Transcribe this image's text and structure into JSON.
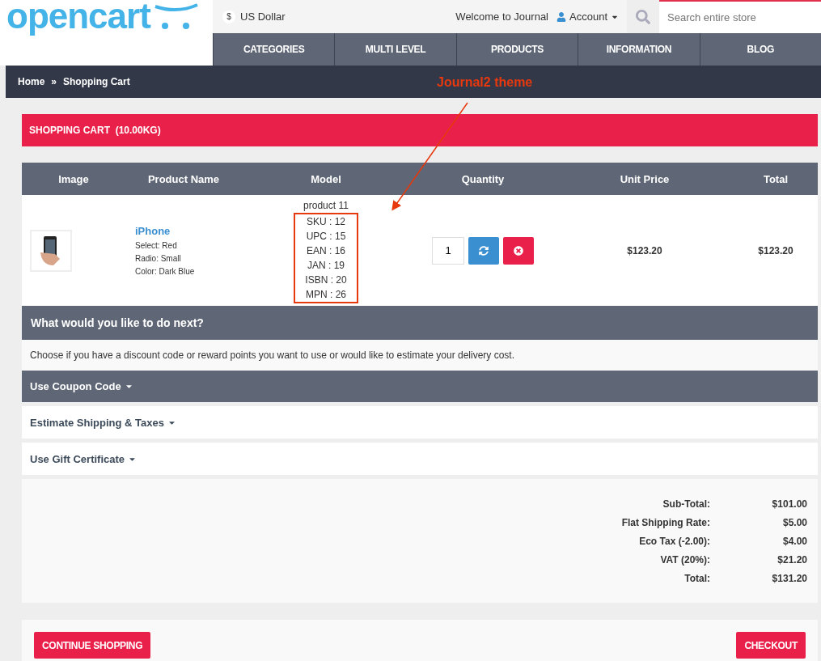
{
  "header": {
    "logo": "opencart",
    "currency_symbol": "$",
    "currency": "US Dollar",
    "welcome": "Welcome to Journal",
    "account": "Account",
    "search": {
      "placeholder": "Search entire store"
    }
  },
  "nav": [
    "CATEGORIES",
    "MULTI LEVEL",
    "PRODUCTS",
    "INFORMATION",
    "BLOG"
  ],
  "breadcrumb": [
    "Home",
    "»",
    "Shopping Cart"
  ],
  "annotation": "Journal2 theme",
  "cart": {
    "title": "SHOPPING CART  (10.00KG)",
    "columns": [
      "Image",
      "Product Name",
      "Model",
      "Quantity",
      "Unit Price",
      "Total"
    ],
    "rows": [
      {
        "name": "iPhone",
        "options": [
          "Select: Red",
          "Radio: Small",
          "Color: Dark Blue"
        ],
        "model": "product 11",
        "codes": [
          "SKU : 12",
          "UPC : 15",
          "EAN : 16",
          "JAN : 19",
          "ISBN : 20",
          "MPN : 26"
        ],
        "quantity": "1",
        "unit_price": "$123.20",
        "total": "$123.20"
      }
    ]
  },
  "next": {
    "title": "What would you like to do next?",
    "description": "Choose if you have a discount code or reward points you want to use or would like to estimate your delivery cost.",
    "sections": [
      {
        "label": "Use Coupon Code",
        "selected": true
      },
      {
        "label": "Estimate Shipping & Taxes",
        "selected": false
      },
      {
        "label": "Use Gift Certificate",
        "selected": false
      }
    ]
  },
  "totals": [
    {
      "label": "Sub-Total:",
      "value": "$101.00"
    },
    {
      "label": "Flat Shipping Rate:",
      "value": "$5.00"
    },
    {
      "label": "Eco Tax (-2.00):",
      "value": "$4.00"
    },
    {
      "label": "VAT (20%):",
      "value": "$21.20"
    },
    {
      "label": "Total:",
      "value": "$131.20"
    }
  ],
  "buttons": [
    "CONTINUE SHOPPING",
    "CHECKOUT"
  ]
}
